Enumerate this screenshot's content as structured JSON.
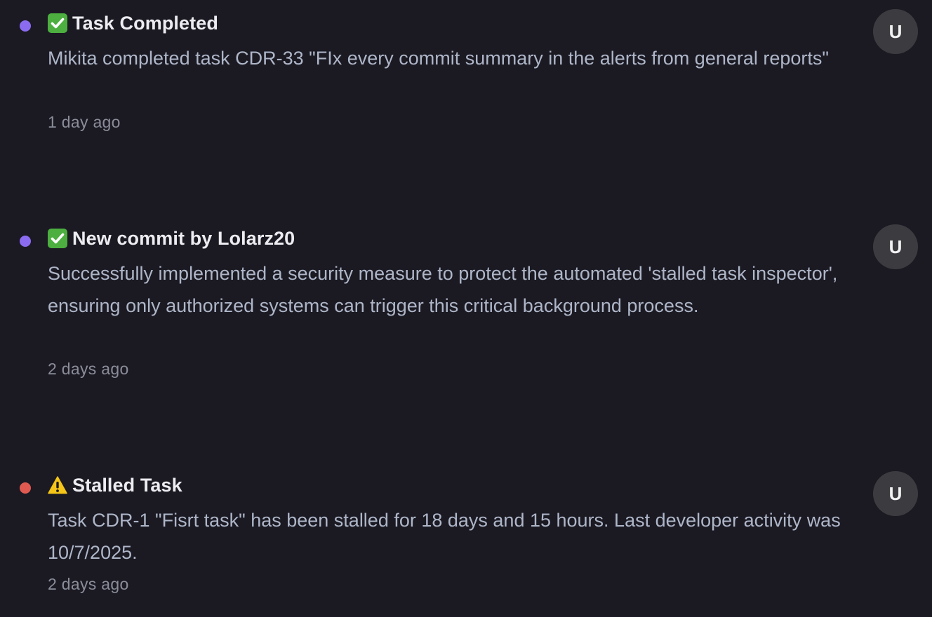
{
  "notifications": [
    {
      "icon": "check-mark-icon",
      "dot_color": "#8b6cf0",
      "title": "Task Completed",
      "body": "Mikita completed task CDR-33 \"FIx every commit summary in the alerts from general reports\"",
      "time": "1 day ago",
      "avatar": "U"
    },
    {
      "icon": "check-mark-icon",
      "dot_color": "#8b6cf0",
      "title": "New commit by Lolarz20",
      "body": "Successfully implemented a security measure to protect the automated 'stalled task inspector', ensuring only authorized systems can trigger this critical background process.",
      "time": "2 days ago",
      "avatar": "U"
    },
    {
      "icon": "warning-icon",
      "dot_color": "#e05a52",
      "title": "Stalled Task",
      "body": "Task CDR-1 \"Fisrt task\" has been stalled for 18 days and 15 hours. Last developer activity was 10/7/2025.",
      "time": "2 days ago",
      "avatar": "U"
    }
  ]
}
